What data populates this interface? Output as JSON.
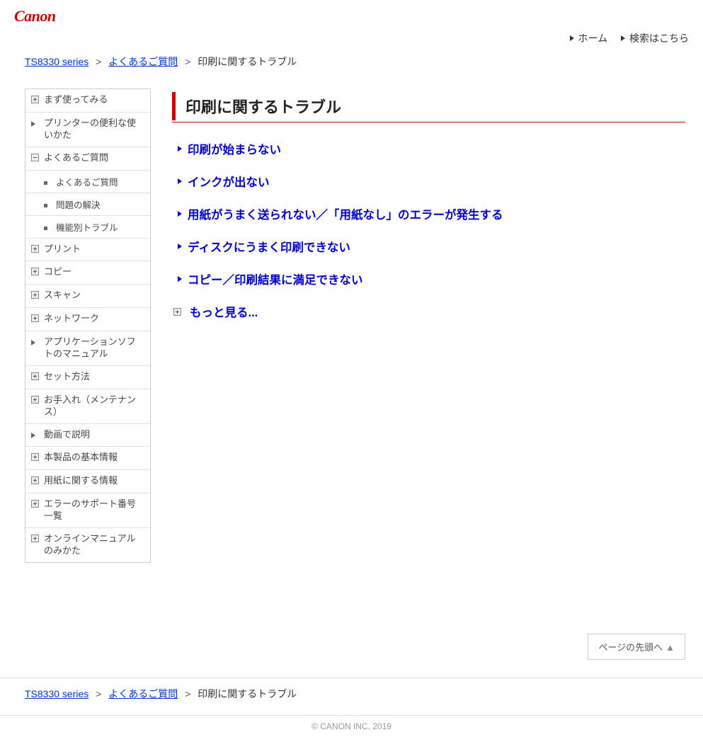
{
  "logo_text": "Canon",
  "header_links": {
    "home": "ホーム",
    "search": "検索はこちら"
  },
  "breadcrumb": {
    "series": "TS8330 series",
    "faq": "よくあるご質問",
    "current": "印刷に関するトラブル"
  },
  "sidebar": [
    {
      "icon": "plus",
      "label": "まず使ってみる"
    },
    {
      "icon": "arrow",
      "label": "プリンターの便利な使いかた"
    },
    {
      "icon": "minus",
      "label": "よくあるご質問",
      "children": [
        {
          "label": "よくあるご質問"
        },
        {
          "label": "問題の解決"
        },
        {
          "label": "機能別トラブル"
        }
      ]
    },
    {
      "icon": "plus",
      "label": "プリント"
    },
    {
      "icon": "plus",
      "label": "コピー"
    },
    {
      "icon": "plus",
      "label": "スキャン"
    },
    {
      "icon": "plus",
      "label": "ネットワーク"
    },
    {
      "icon": "arrow",
      "label": "アプリケーションソフトのマニュアル"
    },
    {
      "icon": "plus",
      "label": "セット方法"
    },
    {
      "icon": "plus",
      "label": "お手入れ（メンテナンス）"
    },
    {
      "icon": "arrow",
      "label": "動画で説明"
    },
    {
      "icon": "plus",
      "label": "本製品の基本情報"
    },
    {
      "icon": "plus",
      "label": "用紙に関する情報"
    },
    {
      "icon": "plus",
      "label": "エラーのサポート番号一覧"
    },
    {
      "icon": "plus",
      "label": "オンラインマニュアルのみかた"
    }
  ],
  "main": {
    "title": "印刷に関するトラブル",
    "topics": [
      "印刷が始まらない",
      "インクが出ない",
      "用紙がうまく送られない／「用紙なし」のエラーが発生する",
      "ディスクにうまく印刷できない",
      "コピー／印刷結果に満足できない"
    ],
    "more_label": "もっと見る..."
  },
  "to_top": "ページの先頭へ",
  "footer": "© CANON INC. 2019"
}
